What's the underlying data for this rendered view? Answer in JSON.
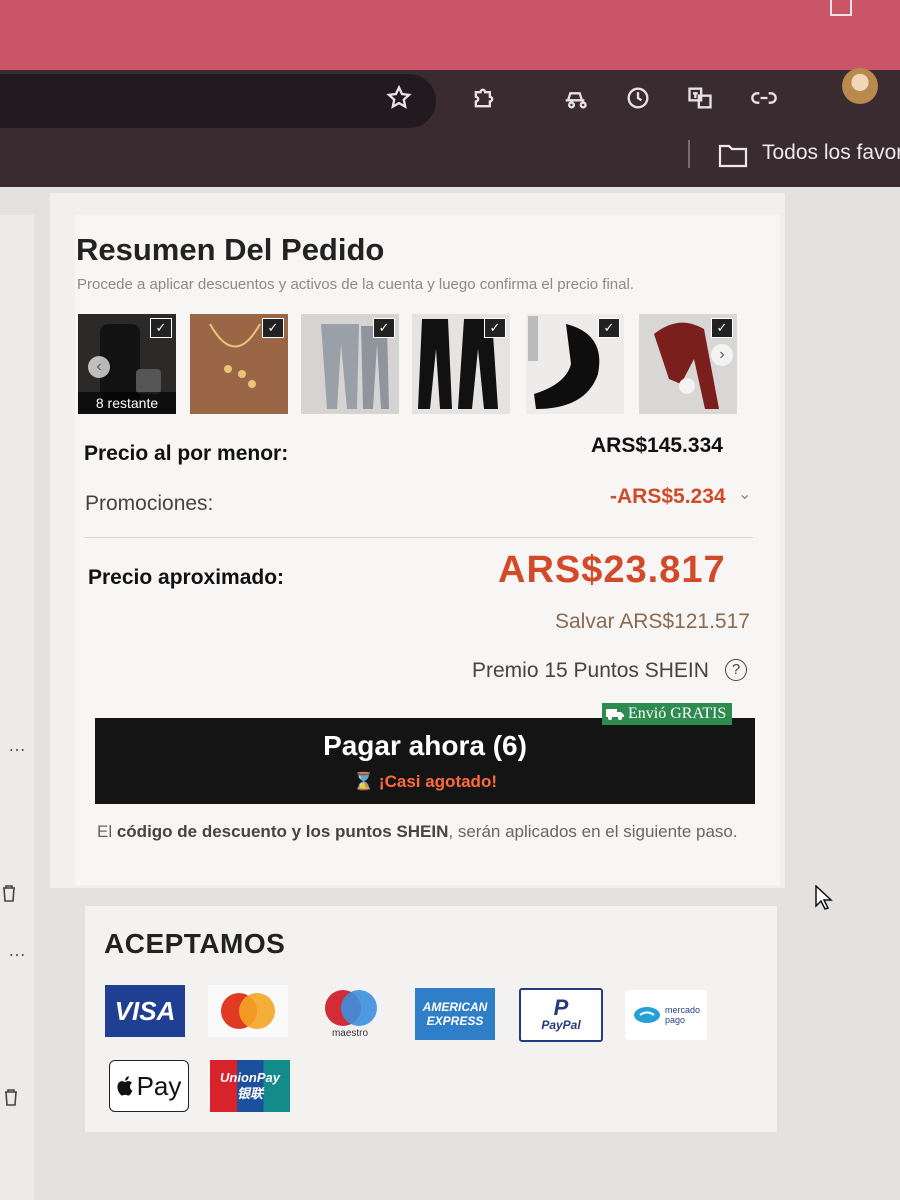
{
  "browser": {
    "bookmarks_folder_label": "Todos los favor"
  },
  "order_summary": {
    "title": "Resumen Del Pedido",
    "subtitle": "Procede a aplicar descuentos y activos de la cuenta y luego confirma el precio final.",
    "remaining_label": "8 restante",
    "check_mark": "✓",
    "retail_price_label": "Precio al por menor:",
    "retail_price_value": "ARS$145.334",
    "promotions_label": "Promociones:",
    "promotions_value": "-ARS$5.234",
    "approx_price_label": "Precio aproximado:",
    "approx_price_value": "ARS$23.817",
    "savings": "Salvar ARS$121.517",
    "reward": "Premio 15 Puntos SHEIN",
    "free_shipping_badge": "Envió GRATIS",
    "pay_button_label": "Pagar ahora (6)",
    "pay_button_sub": "¡Casi agotado!",
    "note_prefix": "El ",
    "note_bold": "código de descuento y los puntos SHEIN",
    "note_suffix": ", serán aplicados en el siguiente paso."
  },
  "payment": {
    "title": "ACEPTAMOS",
    "visa": "VISA",
    "maestro": "maestro",
    "amex_line1": "AMERICAN",
    "amex_line2": "EXPRESS",
    "paypal": "PayPal",
    "mercado_line1": "mercado",
    "mercado_line2": "pago",
    "applepay": "Pay",
    "unionpay_line1": "UnionPay",
    "unionpay_line2": "银联"
  },
  "colors": {
    "accent_price": "#d24a2a",
    "pay_button": "#141414",
    "badge_green": "#2e8b4f",
    "titlebar": "#c95566"
  }
}
